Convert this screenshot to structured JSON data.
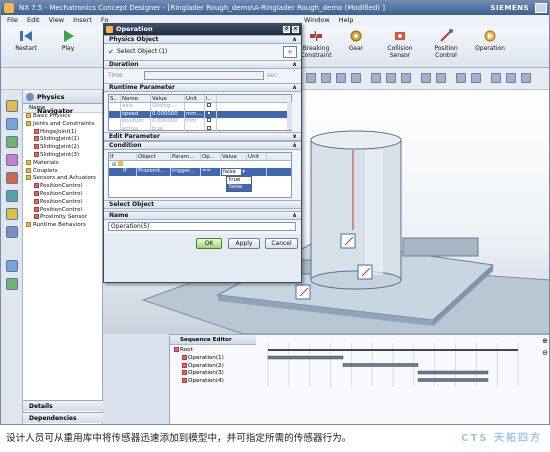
{
  "window": {
    "title": "NX 7.5 - Mechatronics Concept Designer - [Ringlader Rough_demo\\A-Ringlader Rough_demo (Modified) ]",
    "brand": "SIEMENS"
  },
  "menubar": {
    "items_left": [
      "File",
      "Edit",
      "View",
      "Insert",
      "Fo"
    ],
    "items_right": [
      "Window",
      "Help"
    ]
  },
  "ribbon": {
    "buttons": [
      {
        "label": "Restart",
        "icon": "restart-icon"
      },
      {
        "label": "Play",
        "icon": "play-icon"
      },
      {
        "label": "Breaking Constraint",
        "icon": "breaking-constraint-icon"
      },
      {
        "label": "Gear",
        "icon": "gear-icon"
      },
      {
        "label": "Collision Sensor",
        "icon": "collision-sensor-icon"
      },
      {
        "label": "Position Control",
        "icon": "position-control-icon"
      },
      {
        "label": "Operation",
        "icon": "operation-icon"
      }
    ]
  },
  "navigator": {
    "title": "Physics Navigator",
    "column_header": "Name",
    "tree": [
      {
        "label": "Basic Physics",
        "level": 0,
        "kind": "folder"
      },
      {
        "label": "Joints and Constraints",
        "level": 0,
        "kind": "folder"
      },
      {
        "label": "HingeJoint(1)",
        "level": 1,
        "kind": "item"
      },
      {
        "label": "SlidingJoint(1)",
        "level": 1,
        "kind": "item"
      },
      {
        "label": "SlidingJoint(2)",
        "level": 1,
        "kind": "item"
      },
      {
        "label": "SlidingJoint(3)",
        "level": 1,
        "kind": "item"
      },
      {
        "label": "Materials",
        "level": 0,
        "kind": "folder"
      },
      {
        "label": "Couplers",
        "level": 0,
        "kind": "folder"
      },
      {
        "label": "Sensors and Actuators",
        "level": 0,
        "kind": "folder"
      },
      {
        "label": "PositionControl",
        "level": 1,
        "kind": "item"
      },
      {
        "label": "PositionControl",
        "level": 1,
        "kind": "item"
      },
      {
        "label": "PositionControl",
        "level": 1,
        "kind": "item"
      },
      {
        "label": "PositionControl",
        "level": 1,
        "kind": "item"
      },
      {
        "label": "Proximity Sensor",
        "level": 1,
        "kind": "item"
      },
      {
        "label": "Runtime Behaviors",
        "level": 0,
        "kind": "folder"
      }
    ],
    "footer": [
      "Details",
      "Dependencies"
    ]
  },
  "dialog": {
    "title": "Operation",
    "sections": {
      "physics_object": "Physics Object",
      "select_object": "Select Object (1)",
      "duration": "Duration",
      "time_label": "Time",
      "time_value": "",
      "time_unit": "sec",
      "runtime_parameter": "Runtime Parameter",
      "edit_parameter": "Edit Parameter",
      "condition": "Condition",
      "select_object2": "Select Object",
      "name": "Name"
    },
    "runtime_table": {
      "headers": [
        "S..",
        "Name",
        "Value",
        "Unit",
        "I.."
      ],
      "rows": [
        {
          "name": "axis",
          "value": "Sliding...",
          "unit": "",
          "selected": false
        },
        {
          "name": "speed",
          "value": "0.000000",
          "unit": "mm...",
          "selected": true
        },
        {
          "name": "position",
          "value": "0.000000",
          "unit": "mm",
          "selected": false
        },
        {
          "name": "active",
          "value": "true",
          "unit": "",
          "selected": false
        }
      ]
    },
    "condition_table": {
      "headers": [
        "If",
        "Object",
        "Param...",
        "Op...",
        "Value",
        "Unit"
      ],
      "rows": [
        {
          "if": "If",
          "object": "Proximit...",
          "param": "trigger...",
          "op": "==",
          "value": "false",
          "unit": ""
        }
      ]
    },
    "value_dropdown": {
      "options": [
        "true",
        "false"
      ],
      "highlighted": "false"
    },
    "name_value": "Operation(5)",
    "buttons": {
      "ok": "OK",
      "apply": "Apply",
      "cancel": "Cancel"
    }
  },
  "sequence_editor": {
    "title": "Sequence Editor",
    "root": "Root",
    "operations": [
      "Operation(1)",
      "Operation(2)",
      "Operation(3)",
      "Operation(4)"
    ],
    "bars": [
      {
        "start": 0.0,
        "end": 0.3
      },
      {
        "start": 0.3,
        "end": 0.6
      },
      {
        "start": 0.6,
        "end": 0.88
      },
      {
        "start": 0.6,
        "end": 0.88
      }
    ]
  },
  "caption": "设计人员可从重用库中将传感器迅速添加到模型中，并可指定所需的传感器行为。",
  "watermark": "CTS 天拓四方"
}
